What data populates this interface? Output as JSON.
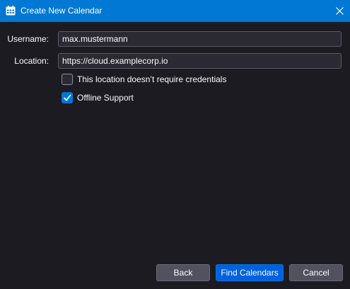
{
  "window": {
    "title": "Create New Calendar",
    "icon": "calendar-icon",
    "close_icon": "close-icon"
  },
  "form": {
    "username": {
      "label": "Username:",
      "value": "max.mustermann"
    },
    "location": {
      "label": "Location:",
      "value": "https://cloud.examplecorp.io"
    },
    "no_credentials": {
      "label": "This location doesn’t require credentials",
      "checked": false
    },
    "offline_support": {
      "label": "Offline Support",
      "checked": true
    }
  },
  "buttons": {
    "back": "Back",
    "find": "Find Calendars",
    "cancel": "Cancel"
  },
  "colors": {
    "titlebar": "#0078d4",
    "background": "#1c1b22",
    "accent": "#0061e0",
    "input_background": "#2b2a33"
  }
}
